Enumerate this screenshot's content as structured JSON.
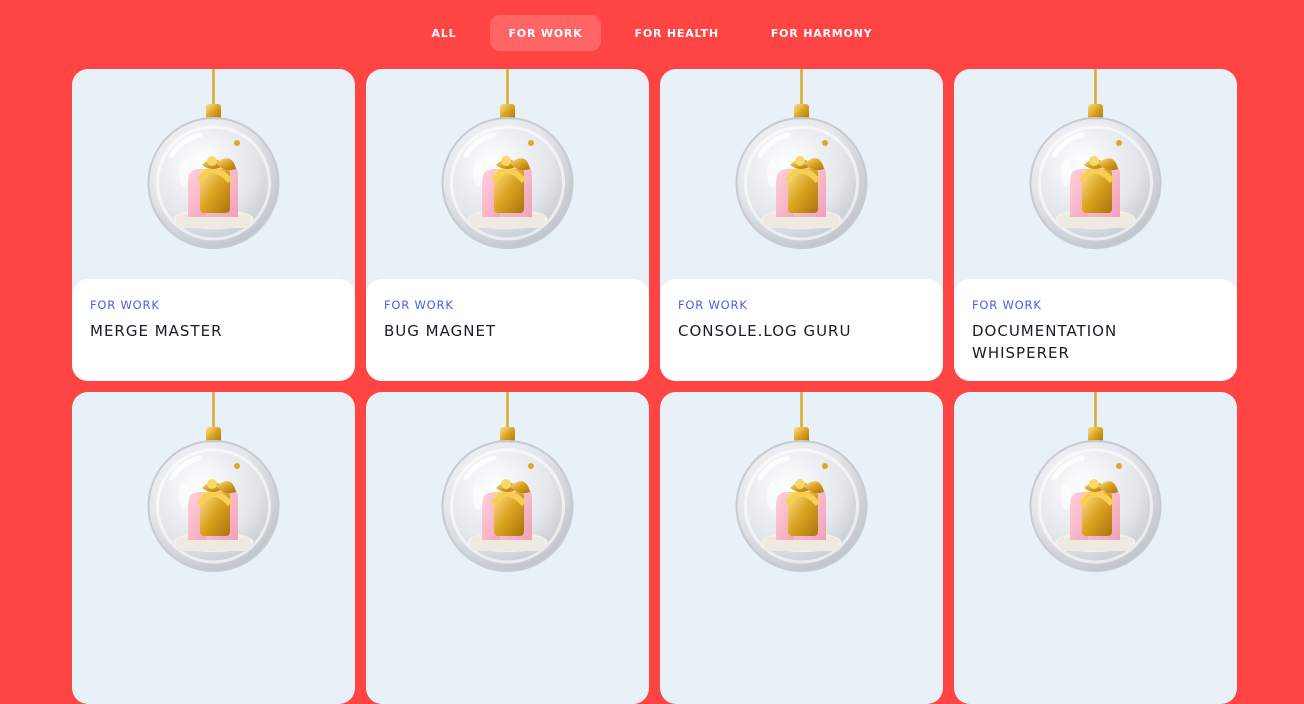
{
  "tabs": [
    {
      "label": "ALL",
      "active": false
    },
    {
      "label": "FOR WORK",
      "active": true
    },
    {
      "label": "FOR HEALTH",
      "active": false
    },
    {
      "label": "FOR HARMONY",
      "active": false
    }
  ],
  "cards": [
    {
      "category": "FOR WORK",
      "title": "MERGE MASTER",
      "image": "christmas-ornament-gift"
    },
    {
      "category": "FOR WORK",
      "title": "BUG MAGNET",
      "image": "christmas-ornament-gift"
    },
    {
      "category": "FOR WORK",
      "title": "CONSOLE.LOG GURU",
      "image": "christmas-ornament-gift"
    },
    {
      "category": "FOR WORK",
      "title": "DOCUMENTATION WHISPERER",
      "image": "christmas-ornament-gift"
    }
  ],
  "colors": {
    "background": "#ff4444",
    "card_image_bg": "#e8f0f8",
    "category": "#4460e6",
    "title": "#1c1c24"
  }
}
